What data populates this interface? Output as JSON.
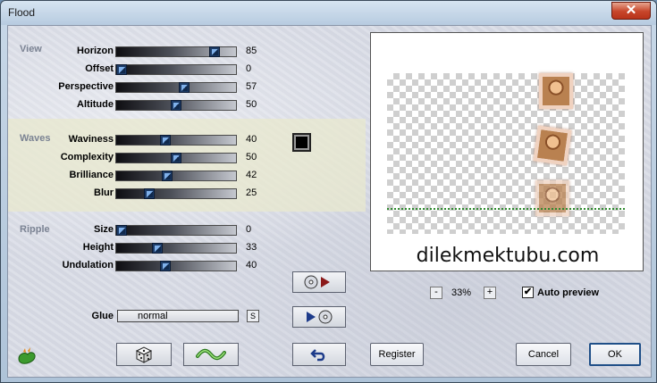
{
  "window": {
    "title": "Flood",
    "close_glyph": "✕"
  },
  "groups": {
    "view": "View",
    "waves": "Waves",
    "ripple": "Ripple"
  },
  "sliders": [
    {
      "label": "Horizon",
      "value": "85",
      "fraction": 0.85
    },
    {
      "label": "Offset",
      "value": "0",
      "fraction": 0.0
    },
    {
      "label": "Perspective",
      "value": "57",
      "fraction": 0.57
    },
    {
      "label": "Altitude",
      "value": "50",
      "fraction": 0.5
    },
    {
      "label": "Waviness",
      "value": "40",
      "fraction": 0.4
    },
    {
      "label": "Complexity",
      "value": "50",
      "fraction": 0.5
    },
    {
      "label": "Brilliance",
      "value": "42",
      "fraction": 0.42
    },
    {
      "label": "Blur",
      "value": "25",
      "fraction": 0.25
    },
    {
      "label": "Size",
      "value": "0",
      "fraction": 0.0
    },
    {
      "label": "Height",
      "value": "33",
      "fraction": 0.33
    },
    {
      "label": "Undulation",
      "value": "40",
      "fraction": 0.4
    }
  ],
  "glue": {
    "label": "Glue",
    "value": "normal",
    "button": "S"
  },
  "preview": {
    "watermark": "dilekmektubu.com"
  },
  "zoom": {
    "minus": "-",
    "value": "33%",
    "plus": "+"
  },
  "auto_preview": {
    "label": "Auto preview",
    "checked": true,
    "check_glyph": "✔"
  },
  "buttons": {
    "register": "Register",
    "cancel": "Cancel",
    "ok": "OK"
  },
  "icons": {
    "plugin_logo": "green-plugin-logo-icon",
    "random": "dice-icon",
    "reset": "wave-icon",
    "save_preset": "disc-to-arrow-icon",
    "load_preset": "arrow-to-disc-icon",
    "undo": "undo-arrow-icon",
    "swatch": "color-swatch-icon"
  },
  "colors": {
    "accent": "#1f4f88",
    "waves_band": "#e8e8cd",
    "horizon_line": "#2e8a2e",
    "swatch": "#000000"
  }
}
